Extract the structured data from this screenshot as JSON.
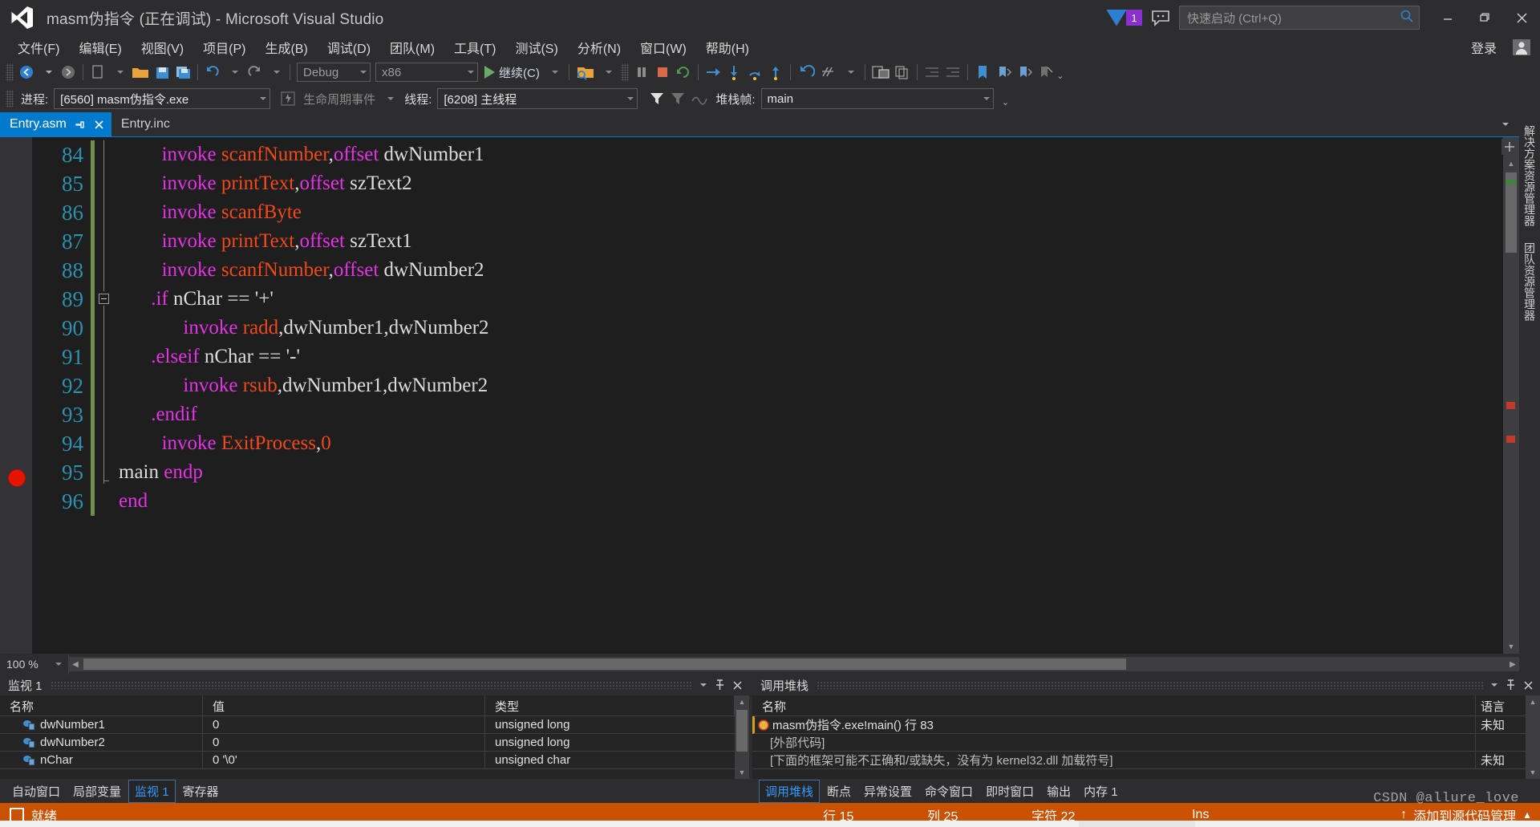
{
  "window": {
    "title": "masm伪指令 (正在调试) - Microsoft Visual Studio",
    "logo_icon": "visual-studio-logo",
    "notification_count": "1",
    "feedback_icon": "feedback-smiley-icon",
    "quick_launch_placeholder": "快速启动 (Ctrl+Q)",
    "quick_launch_value": "",
    "search_icon": "search-icon",
    "minimize_icon": "minimize-icon",
    "restore_icon": "restore-icon",
    "close_icon": "close-icon"
  },
  "menubar": {
    "items": [
      {
        "label": "文件(F)"
      },
      {
        "label": "编辑(E)"
      },
      {
        "label": "视图(V)"
      },
      {
        "label": "项目(P)"
      },
      {
        "label": "生成(B)"
      },
      {
        "label": "调试(D)"
      },
      {
        "label": "团队(M)"
      },
      {
        "label": "工具(T)"
      },
      {
        "label": "测试(S)"
      },
      {
        "label": "分析(N)"
      },
      {
        "label": "窗口(W)"
      },
      {
        "label": "帮助(H)"
      }
    ],
    "signin_label": "登录",
    "account_icon": "account-icon"
  },
  "toolbar": {
    "navigate_back_icon": "navigate-back-icon",
    "navigate_forward_icon": "navigate-forward-icon",
    "new_item_icon": "new-item-icon",
    "open_file_icon": "open-file-icon",
    "save_icon": "save-icon",
    "save_all_icon": "save-all-icon",
    "undo_icon": "undo-icon",
    "redo_icon": "redo-icon",
    "config_value": "Debug",
    "platform_value": "x86",
    "continue_label": "继续(C)",
    "start_icon": "start-debug-icon",
    "attach_icon": "attach-to-process-icon",
    "pause_icon": "pause-icon",
    "stop_icon": "stop-debugging-icon",
    "restart_icon": "restart-icon",
    "show_next_statement_icon": "show-next-statement-icon",
    "step_into_icon": "step-into-icon",
    "step_over_icon": "step-over-icon",
    "step_out_icon": "step-out-icon",
    "undo2_icon": "undo-arrow-icon",
    "hotreload_icon": "hot-reload-icon",
    "windows_layout_icon": "window-layout-icon",
    "copy_icon": "copy-icon",
    "indent_icon": "indent-icon",
    "outdent_icon": "outdent-icon",
    "bookmark_icon": "bookmark-icon",
    "prev_bookmark_icon": "previous-bookmark-icon",
    "next_bookmark_icon": "next-bookmark-icon",
    "clear_bookmarks_icon": "clear-bookmarks-icon"
  },
  "debug_bar": {
    "process_label": "进程:",
    "process_value": "[6560] masm伪指令.exe",
    "lifecycle_label": "生命周期事件",
    "lifecycle_icon": "lifecycle-events-icon",
    "thread_label": "线程:",
    "thread_value": "[6208] 主线程",
    "filter_icon": "filter-icon",
    "filter_clear_icon": "clear-filter-icon",
    "flatten_icon": "flatten-callstack-icon",
    "stackframe_label": "堆栈帧:",
    "stackframe_value": "main"
  },
  "document_tabs": [
    {
      "label": "Entry.asm",
      "active": true,
      "pin_icon": "pin-icon",
      "close_icon": "close-tab-icon"
    },
    {
      "label": "Entry.inc",
      "active": false
    }
  ],
  "editor": {
    "zoom": "100 %",
    "first_visible_line": 84,
    "breakpoint_line": 94,
    "lines": [
      {
        "n": "84",
        "indent": 4,
        "tokens": [
          {
            "t": "invoke",
            "c": "k-invoke"
          },
          {
            "t": " ",
            "c": "k-plain"
          },
          {
            "t": "scanfNumber",
            "c": "k-fn"
          },
          {
            "t": ",",
            "c": "k-plain"
          },
          {
            "t": "offset",
            "c": "k-off"
          },
          {
            "t": " dwNumber1",
            "c": "k-var"
          }
        ]
      },
      {
        "n": "85",
        "indent": 4,
        "tokens": [
          {
            "t": "invoke",
            "c": "k-invoke"
          },
          {
            "t": " ",
            "c": "k-plain"
          },
          {
            "t": "printText",
            "c": "k-fn"
          },
          {
            "t": ",",
            "c": "k-plain"
          },
          {
            "t": "offset",
            "c": "k-off"
          },
          {
            "t": " szText2",
            "c": "k-var"
          }
        ]
      },
      {
        "n": "86",
        "indent": 4,
        "tokens": [
          {
            "t": "invoke",
            "c": "k-invoke"
          },
          {
            "t": " ",
            "c": "k-plain"
          },
          {
            "t": "scanfByte",
            "c": "k-fn"
          }
        ]
      },
      {
        "n": "87",
        "indent": 4,
        "tokens": [
          {
            "t": "invoke",
            "c": "k-invoke"
          },
          {
            "t": " ",
            "c": "k-plain"
          },
          {
            "t": "printText",
            "c": "k-fn"
          },
          {
            "t": ",",
            "c": "k-plain"
          },
          {
            "t": "offset",
            "c": "k-off"
          },
          {
            "t": " szText1",
            "c": "k-var"
          }
        ]
      },
      {
        "n": "88",
        "indent": 4,
        "tokens": [
          {
            "t": "invoke",
            "c": "k-invoke"
          },
          {
            "t": " ",
            "c": "k-plain"
          },
          {
            "t": "scanfNumber",
            "c": "k-fn"
          },
          {
            "t": ",",
            "c": "k-plain"
          },
          {
            "t": "offset",
            "c": "k-off"
          },
          {
            "t": " dwNumber2",
            "c": "k-var"
          }
        ]
      },
      {
        "n": "89",
        "indent": 3,
        "fold": "start",
        "tokens": [
          {
            "t": ".if",
            "c": "k-dir"
          },
          {
            "t": " nChar == '+'",
            "c": "k-var"
          }
        ]
      },
      {
        "n": "90",
        "indent": 6,
        "tokens": [
          {
            "t": "invoke",
            "c": "k-invoke"
          },
          {
            "t": " ",
            "c": "k-plain"
          },
          {
            "t": "radd",
            "c": "k-fn"
          },
          {
            "t": ",dwNumber1,dwNumber2",
            "c": "k-var"
          }
        ]
      },
      {
        "n": "91",
        "indent": 3,
        "tokens": [
          {
            "t": ".elseif",
            "c": "k-dir"
          },
          {
            "t": " nChar == '-'",
            "c": "k-var"
          }
        ]
      },
      {
        "n": "92",
        "indent": 6,
        "tokens": [
          {
            "t": "invoke",
            "c": "k-invoke"
          },
          {
            "t": " ",
            "c": "k-plain"
          },
          {
            "t": "rsub",
            "c": "k-fn"
          },
          {
            "t": ",dwNumber1,dwNumber2",
            "c": "k-var"
          }
        ]
      },
      {
        "n": "93",
        "indent": 3,
        "tokens": [
          {
            "t": ".endif",
            "c": "k-dir"
          }
        ]
      },
      {
        "n": "94",
        "indent": 4,
        "breakpoint": true,
        "tokens": [
          {
            "t": "invoke",
            "c": "k-invoke"
          },
          {
            "t": " ",
            "c": "k-plain"
          },
          {
            "t": "ExitProcess",
            "c": "k-fn"
          },
          {
            "t": ",",
            "c": "k-plain"
          },
          {
            "t": "0",
            "c": "k-num"
          }
        ]
      },
      {
        "n": "95",
        "indent": 0,
        "tokens": [
          {
            "t": "main ",
            "c": "k-var"
          },
          {
            "t": "endp",
            "c": "k-dir"
          }
        ]
      },
      {
        "n": "96",
        "indent": 0,
        "tokens": [
          {
            "t": "end",
            "c": "k-dir"
          }
        ]
      }
    ]
  },
  "right_dock": {
    "tabs": [
      {
        "label": "解决方案资源管理器"
      },
      {
        "label": "团队资源管理器"
      }
    ]
  },
  "watch_panel": {
    "title": "监视 1",
    "dropdown_icon": "chevron-down-icon",
    "pin_icon": "pin-icon",
    "close_icon": "close-icon",
    "columns": [
      "名称",
      "值",
      "类型"
    ],
    "rows": [
      {
        "name": "dwNumber1",
        "value": "0",
        "type": "unsigned long",
        "icon": "variable-icon"
      },
      {
        "name": "dwNumber2",
        "value": "0",
        "type": "unsigned long",
        "icon": "variable-icon"
      },
      {
        "name": "nChar",
        "value": "0 '\\0'",
        "type": "unsigned char",
        "icon": "variable-icon"
      }
    ],
    "tabs": [
      {
        "label": "自动窗口",
        "active": false
      },
      {
        "label": "局部变量",
        "active": false
      },
      {
        "label": "监视 1",
        "active": true
      },
      {
        "label": "寄存器",
        "active": false
      }
    ]
  },
  "callstack_panel": {
    "title": "调用堆栈",
    "dropdown_icon": "chevron-down-icon",
    "pin_icon": "pin-icon",
    "close_icon": "close-icon",
    "columns": [
      "名称",
      "语言"
    ],
    "rows": [
      {
        "name": "masm伪指令.exe!main() 行 83",
        "lang": "未知",
        "icon": "current-frame-icon",
        "active": true
      },
      {
        "name": "[外部代码]",
        "lang": "",
        "icon": "",
        "active": false
      },
      {
        "name": "[下面的框架可能不正确和/或缺失，没有为 kernel32.dll 加载符号]",
        "lang": "未知",
        "icon": "",
        "active": false
      }
    ],
    "tabs": [
      {
        "label": "调用堆栈",
        "active": true
      },
      {
        "label": "断点",
        "active": false
      },
      {
        "label": "异常设置",
        "active": false
      },
      {
        "label": "命令窗口",
        "active": false
      },
      {
        "label": "即时窗口",
        "active": false
      },
      {
        "label": "输出",
        "active": false
      },
      {
        "label": "内存 1",
        "active": false
      }
    ]
  },
  "statusbar": {
    "icon": "ready-icon",
    "status": "就绪",
    "line": "行 15",
    "column": "列 25",
    "char": "字符 22",
    "insert_mode": "Ins",
    "source_control": "添加到源代码管理",
    "up_arrow_icon": "upload-icon",
    "expand_icon": "expand-icon"
  },
  "watermark": "CSDN @allure_love"
}
